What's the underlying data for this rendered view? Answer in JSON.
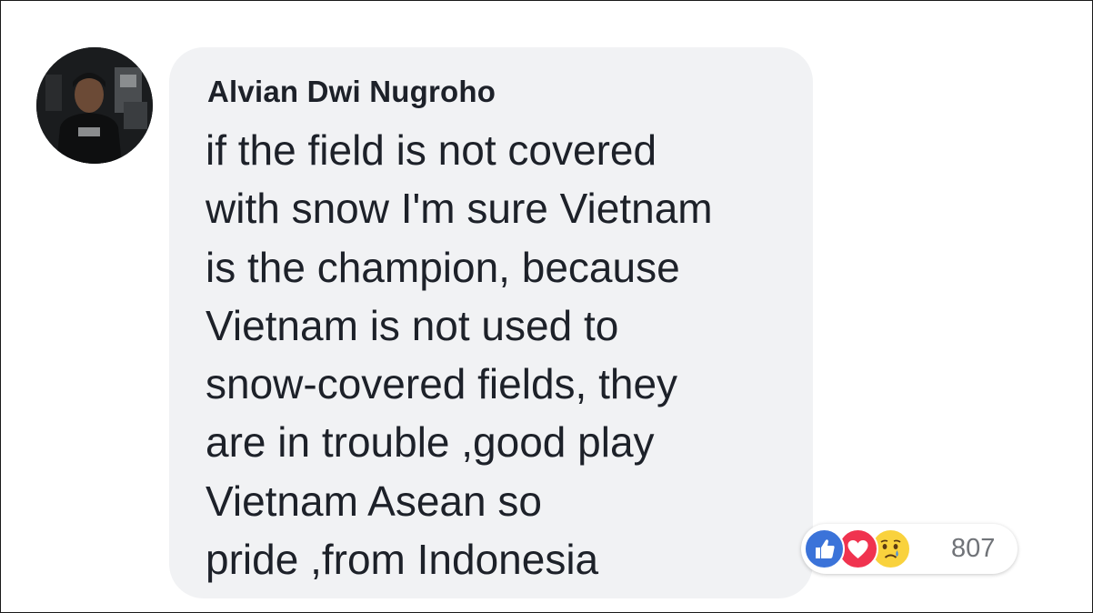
{
  "comment": {
    "author": "Alvian Dwi Nugroho",
    "text_lines": [
      "if the field is not covered",
      "with snow I'm sure Vietnam",
      "is the champion, because",
      "Vietnam is not used to",
      "snow-covered fields, they",
      "are in trouble ,good play",
      "Vietnam Asean so",
      "pride ,from Indonesia"
    ],
    "reactions": {
      "types": [
        "like-icon",
        "love-icon",
        "sad-icon"
      ],
      "count": "807"
    }
  },
  "colors": {
    "bubble_bg": "#f1f2f4",
    "text": "#1d2129",
    "like": "#3b73d9",
    "love": "#f0334f",
    "sad": "#f9d23d",
    "count_text": "#707378"
  }
}
